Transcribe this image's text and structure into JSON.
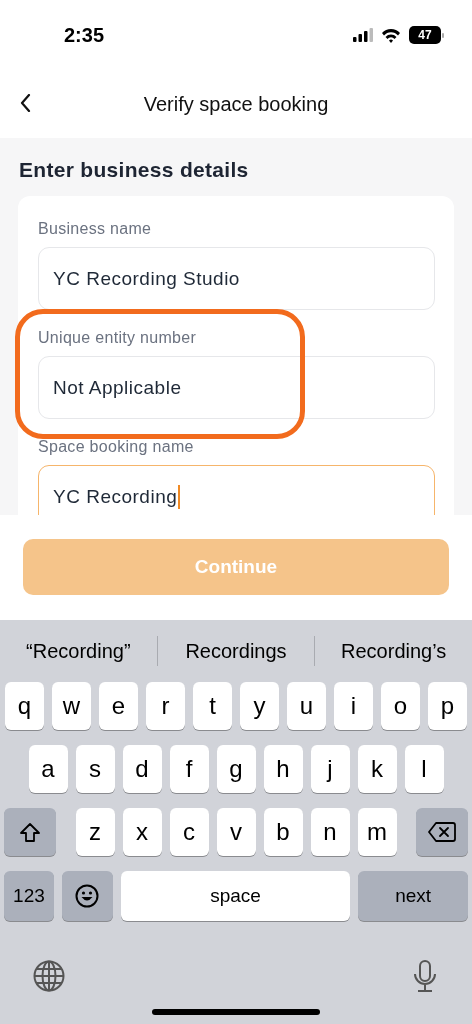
{
  "status_bar": {
    "time": "2:35",
    "battery": "47"
  },
  "nav": {
    "title": "Verify space booking"
  },
  "section": {
    "heading": "Enter business details"
  },
  "fields": [
    {
      "label": "Business name",
      "value": "YC Recording Studio",
      "focused": false,
      "highlighted": false
    },
    {
      "label": "Unique entity number",
      "value": "Not Applicable",
      "focused": false,
      "highlighted": true
    },
    {
      "label": "Space booking name",
      "value": "YC Recording",
      "focused": true,
      "highlighted": false
    }
  ],
  "continue_button": {
    "label": "Continue",
    "disabled": true
  },
  "keyboard": {
    "suggestions": [
      "“Recording”",
      "Recordings",
      "Recording’s"
    ],
    "rows": [
      [
        "q",
        "w",
        "e",
        "r",
        "t",
        "y",
        "u",
        "i",
        "o",
        "p"
      ],
      [
        "a",
        "s",
        "d",
        "f",
        "g",
        "h",
        "j",
        "k",
        "l"
      ],
      [
        "z",
        "x",
        "c",
        "v",
        "b",
        "n",
        "m"
      ]
    ],
    "bottom_row": [
      {
        "kind": "numbers",
        "label": "123"
      },
      {
        "kind": "emoji"
      },
      {
        "kind": "space",
        "label": "space"
      },
      {
        "kind": "return",
        "label": "next"
      }
    ]
  }
}
